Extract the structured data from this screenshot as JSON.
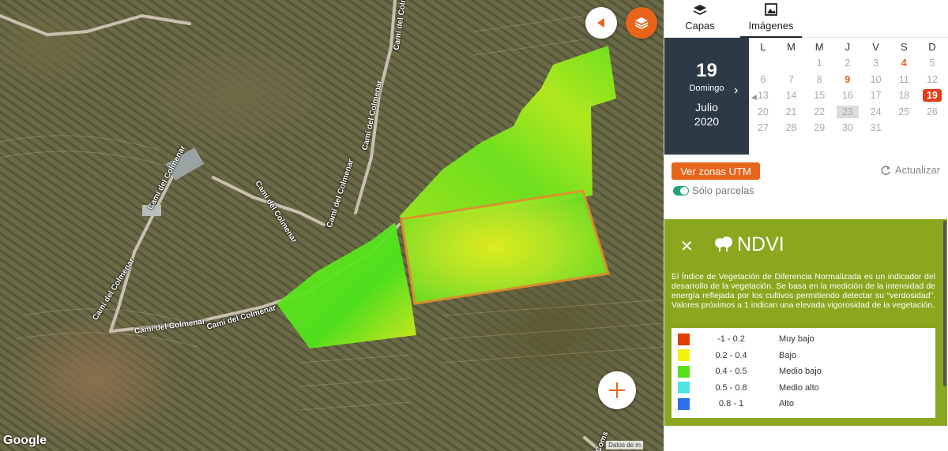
{
  "map": {
    "road_labels": [
      "Camí del Colmenar",
      "Camí del Colmenar",
      "Camí del Colmenar",
      "Camí del Colmenar",
      "Camí del Colmenar",
      "Camí del Colmenar",
      "Camí del Colmenar",
      "Camí del Colmenar"
    ],
    "road_fragment": "Coms",
    "google_label": "Google",
    "attribution": "Datos de m",
    "ndvi_colors": [
      "#e23d00",
      "#f2f20a",
      "#6ee61c",
      "#4ee4e8",
      "#2f6fe8"
    ]
  },
  "tabs": [
    {
      "label": "Capas",
      "icon": "layers-icon"
    },
    {
      "label": "Imágenes",
      "icon": "image-icon"
    }
  ],
  "date_card": {
    "day": "19",
    "weekday": "Domingo",
    "month": "Julio",
    "year": "2020"
  },
  "calendar": {
    "weekdays": [
      "L",
      "M",
      "M",
      "J",
      "V",
      "S",
      "D"
    ],
    "weeks": [
      [
        "",
        "",
        "1",
        "2",
        "3",
        "4",
        "5"
      ],
      [
        "6",
        "7",
        "8",
        "9",
        "10",
        "11",
        "12"
      ],
      [
        "13",
        "14",
        "15",
        "16",
        "17",
        "18",
        "19"
      ],
      [
        "20",
        "21",
        "22",
        "23",
        "24",
        "25",
        "26"
      ],
      [
        "27",
        "28",
        "29",
        "30",
        "31",
        "",
        ""
      ]
    ],
    "highlighted_days": [
      "4",
      "9"
    ],
    "selected_day": "19",
    "today": "23"
  },
  "controls": {
    "utm_button": "Ver zonas UTM",
    "refresh": "Actualizar",
    "parcels_toggle": "Sólo parcelas"
  },
  "ndvi": {
    "title": "NDVI",
    "description": "El Índice de Vegetación de Diferencia Normalizada es un indicador del desarrollo de la vegetación. Se basa en la medición de la intensidad de energía reflejada por los cultivos permitiendo detectar su “verdosidad”. Valores próximos a 1 indican una elevada vigorosidad de la vegetación.",
    "legend": [
      {
        "range": "-1 - 0.2",
        "label": "Muy bajo",
        "color": "#e23d00"
      },
      {
        "range": "0.2 - 0.4",
        "label": "Bajo",
        "color": "#f2f20a"
      },
      {
        "range": "0.4 - 0.5",
        "label": "Medio bajo",
        "color": "#55e01a"
      },
      {
        "range": "0.5 - 0.8",
        "label": "Medio alto",
        "color": "#4ee4e8"
      },
      {
        "range": "0.8 - 1",
        "label": "Alto",
        "color": "#2f6fe8"
      }
    ]
  }
}
